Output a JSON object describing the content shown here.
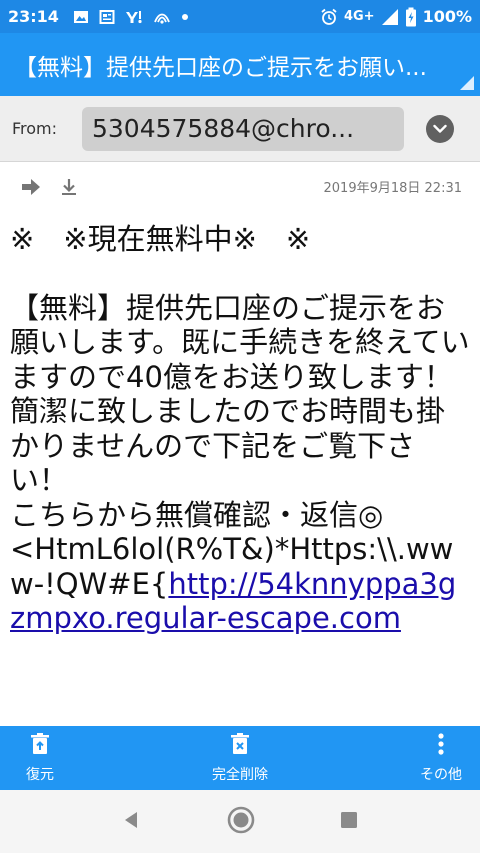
{
  "status_bar": {
    "time": "23:14",
    "network": "4G+",
    "battery": "100%"
  },
  "header": {
    "title": "【無料】提供先口座のご提示をお願い..."
  },
  "from": {
    "label": "From:",
    "address": "5304575884@chro..."
  },
  "mail": {
    "date": "2019年9月18日 22:31",
    "line1": "※　※現在無料中※　※",
    "para": "【無料】提供先口座のご提示をお願いします。既に手続きを終えていますので40億をお送り致します！簡潔に致しましたのでお時間も掛かりませんので下記をご覧下さい！",
    "line_confirm": "こちらから無償確認・返信◎",
    "url_prefix": " <HtmL6lol(R%T&)*Https:\\\\.www-!QW#E{",
    "url_link": "http://54knnyppa3gzmpxo.regular-escape.com"
  },
  "bottom_bar": {
    "restore_label": "復元",
    "delete_label": "完全削除",
    "more_label": "その他"
  },
  "colors": {
    "status_bar": "#1e88e5",
    "title_bar": "#2196f3",
    "link": "#1a0dab"
  },
  "icons": {
    "restore": "restore-icon",
    "delete": "delete-forever-icon",
    "more": "more-vertical-icon",
    "forward": "forward-arrow-icon",
    "download": "download-icon",
    "expand": "chevron-down-icon"
  }
}
